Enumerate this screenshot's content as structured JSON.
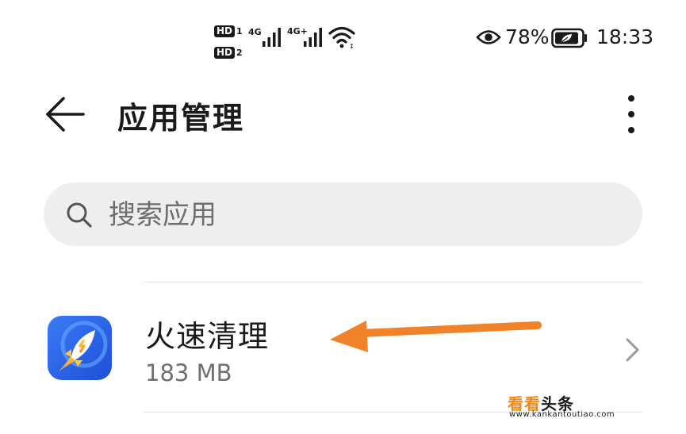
{
  "status_bar": {
    "sim1_label": "HD",
    "sim1_index": "1",
    "sim2_label": "HD",
    "sim2_index": "2",
    "network1": "4G",
    "network2": "4G+",
    "battery_percent": "78%",
    "time": "18:33",
    "icons": [
      "signal-icon",
      "wifi-icon",
      "eye-icon",
      "battery-icon"
    ]
  },
  "header": {
    "back_icon": "back-arrow-icon",
    "title": "应用管理",
    "more_icon": "more-vertical-icon"
  },
  "search": {
    "icon": "search-icon",
    "placeholder": "搜索应用"
  },
  "apps": [
    {
      "name": "火速清理",
      "size": "183 MB",
      "icon": "rocket-app-icon"
    }
  ],
  "annotation": {
    "icon": "orange-arrow-icon",
    "color": "#f0832a"
  },
  "watermark": {
    "brand_part1": "看看",
    "brand_part2": "头条",
    "url": "www.kankantoutiao.com"
  },
  "colors": {
    "app_icon_bg": "#2563e6",
    "arrow": "#f0832a",
    "search_bg": "#eeeeee"
  }
}
